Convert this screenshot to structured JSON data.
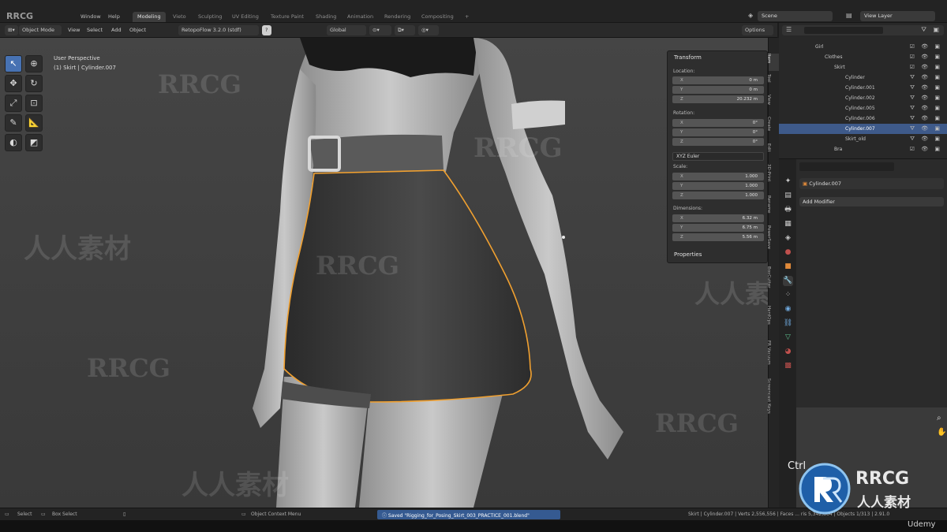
{
  "menu": [
    "Window",
    "Help"
  ],
  "workspace_tabs": [
    "Modeling",
    "Vieto",
    "Sculpting",
    "UV Editing",
    "Texture Paint",
    "Shading",
    "Animation",
    "Rendering",
    "Compositing",
    "+"
  ],
  "scene_field": "Scene",
  "view_layer_field": "View Layer",
  "viewport_header": {
    "mode": "Object Mode",
    "view": "View",
    "select": "Select",
    "add": "Add",
    "object": "Object",
    "addon": "RetopoFlow 3.2.0 (stdf)",
    "orientation": "Global",
    "options": "Options"
  },
  "viewport": {
    "perspective": "User Perspective",
    "object": "(1) Skirt | Cylinder.007"
  },
  "tools": [
    "select-box",
    "cursor",
    "move",
    "rotate",
    "scale",
    "transform",
    "annotate",
    "measure",
    "loop",
    "shade"
  ],
  "npanel": {
    "transform_title": "Transform",
    "location_label": "Location:",
    "location": [
      [
        "X",
        "0 m"
      ],
      [
        "Y",
        "0 m"
      ],
      [
        "Z",
        "20.232 m"
      ]
    ],
    "rotation_label": "Rotation:",
    "rotation": [
      [
        "X",
        "0°"
      ],
      [
        "Y",
        "0°"
      ],
      [
        "Z",
        "0°"
      ]
    ],
    "rotation_mode": "XYZ Euler",
    "scale_label": "Scale:",
    "scale": [
      [
        "X",
        "1.000"
      ],
      [
        "Y",
        "1.000"
      ],
      [
        "Z",
        "1.000"
      ]
    ],
    "dimensions_label": "Dimensions:",
    "dimensions": [
      [
        "X",
        "6.32 m"
      ],
      [
        "Y",
        "6.75 m"
      ],
      [
        "Z",
        "5.56 m"
      ]
    ],
    "properties_title": "Properties"
  },
  "side_tabs": [
    "Item",
    "Tool",
    "View",
    "Create",
    "Edit",
    "3D-Print",
    "Rename",
    "PowerSave",
    "BoxCutter",
    "HardOps",
    "FR Vacuum",
    "Screencast Keys"
  ],
  "outliner": [
    {
      "text": "Girl",
      "indent": 1
    },
    {
      "text": "Clothes",
      "indent": 2
    },
    {
      "text": "Skirt",
      "indent": 3
    },
    {
      "text": "Cylinder",
      "indent": 4
    },
    {
      "text": "Cylinder.001",
      "indent": 4
    },
    {
      "text": "Cylinder.002",
      "indent": 4
    },
    {
      "text": "Cylinder.005",
      "indent": 4
    },
    {
      "text": "Cylinder.006",
      "indent": 4
    },
    {
      "text": "Cylinder.007",
      "indent": 4,
      "highlight": true
    },
    {
      "text": "Skirt_old",
      "indent": 4
    },
    {
      "text": "Bra",
      "indent": 3
    }
  ],
  "properties": {
    "object_name": "Cylinder.007",
    "add_modifier": "Add Modifier"
  },
  "status": {
    "select": "Select",
    "box_select": "Box Select",
    "context_menu": "Object Context Menu",
    "saved": "Saved \"Rigging_for_Posing_Skirt_003_PRACTICE_001.blend\"",
    "stats": "Skirt | Cylinder.007 | Verts 2,556,556 | Faces ... ris 5,342,864 | Objects 1/313 | 2.91.0"
  },
  "overlay": {
    "ctrl": "Ctrl",
    "logo_top": "RRCG",
    "logo_bottom": "人人素材",
    "udemy": "Udemy",
    "watermark_latin": "RRCG",
    "watermark_cjk": "人人素材"
  },
  "colors": {
    "accent": "#4772b3",
    "selection_outline": "#f0a030",
    "highlight_row": "#3e5a8a"
  }
}
